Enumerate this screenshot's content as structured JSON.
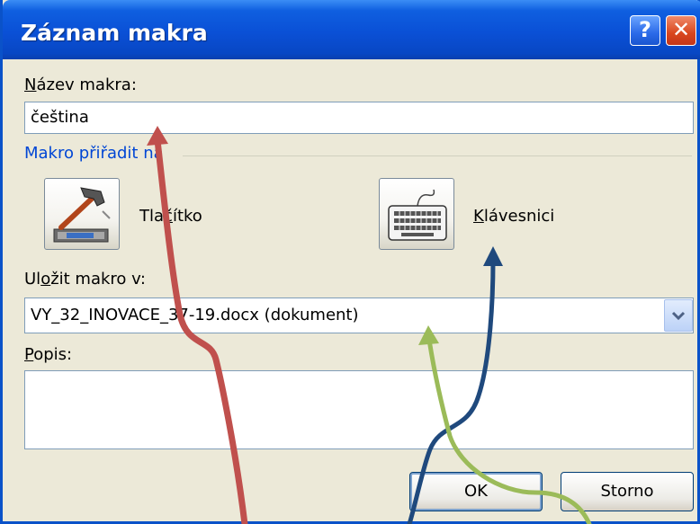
{
  "window": {
    "title": "Záznam makra",
    "help_icon": "?",
    "close_icon": "✕"
  },
  "macro_name": {
    "label_underlined": "N",
    "label_rest": "ázev makra:",
    "value": "čeština"
  },
  "assign_group": {
    "label": "Makro přiřadit na"
  },
  "assign_button": {
    "icon": "hammer-icon",
    "label_pre": "Tla",
    "label_underlined": "č",
    "label_rest": "ítko"
  },
  "assign_keyboard": {
    "icon": "keyboard-icon",
    "label_underlined": "K",
    "label_rest": "lávesnici"
  },
  "store_in": {
    "label_pre": "Ul",
    "label_underlined": "o",
    "label_rest": "žit makro v:",
    "value": "VY_32_INOVACE_37-19.docx (dokument)"
  },
  "description": {
    "label_underlined": "P",
    "label_rest": "opis:",
    "value": ""
  },
  "buttons": {
    "ok": "OK",
    "cancel": "Storno"
  },
  "annotation_colors": {
    "red": "#c0504d",
    "navy": "#1f497d",
    "green": "#9bbb59"
  }
}
